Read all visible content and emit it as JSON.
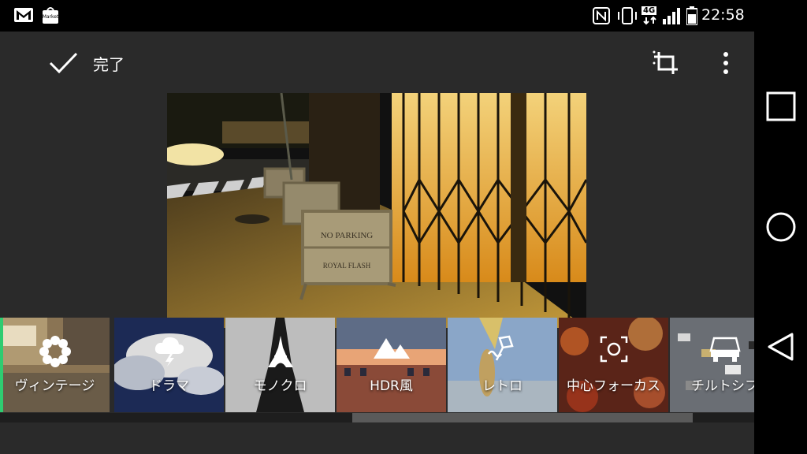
{
  "status_bar": {
    "time": "22:58",
    "market_label": "Market",
    "network_label": "4G",
    "icons": [
      "gmail-icon",
      "market-icon",
      "nfc-icon",
      "vibrate-icon",
      "network-4g-icon",
      "signal-icon",
      "battery-icon"
    ]
  },
  "toolbar": {
    "done_label": "完了",
    "icons": [
      "checkmark-icon",
      "crop-icon",
      "more-vert-icon"
    ]
  },
  "photo": {
    "sign_line1": "NO PARKING",
    "sign_line2": "ROYAL FLASH"
  },
  "filters": [
    {
      "label": "ヴィンテージ",
      "icon": "flower-icon",
      "selected": true
    },
    {
      "label": "ドラマ",
      "icon": "storm-cloud-icon",
      "selected": false
    },
    {
      "label": "モノクロ",
      "icon": "tower-icon",
      "selected": false
    },
    {
      "label": "HDR風",
      "icon": "mountain-icon",
      "selected": false
    },
    {
      "label": "レトロ",
      "icon": "retro-kite-icon",
      "selected": false
    },
    {
      "label": "中心フォーカス",
      "icon": "focus-icon",
      "selected": false
    },
    {
      "label": "チルトシフ",
      "icon": "car-icon",
      "selected": false
    }
  ],
  "nav_bar": {
    "icons": [
      "recents-icon",
      "home-icon",
      "back-icon"
    ]
  },
  "colors": {
    "app_bg": "#2a2a2a",
    "selected_accent": "#2ecc71",
    "status_bg": "#000000"
  }
}
